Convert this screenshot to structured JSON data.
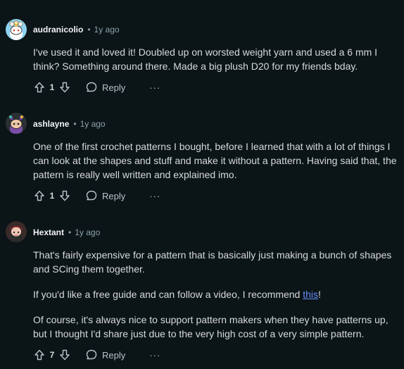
{
  "comments": [
    {
      "author": "audranicolio",
      "separator": "•",
      "time": "1y ago",
      "avatar_icon": "snoo-avatar-white-flower-hat",
      "paragraphs": [
        "I've used it and loved it! Doubled up on worsted weight yarn and used a 6 mm I think? Something around there. Made a big plush D20 for my friends bday."
      ],
      "votes": "1",
      "reply_label": "Reply",
      "more_label": "···"
    },
    {
      "author": "ashlayne",
      "separator": "•",
      "time": "1y ago",
      "avatar_icon": "snoo-avatar-purple-ears",
      "paragraphs": [
        "One of the first crochet patterns I bought, before I learned that with a lot of things I can look at the shapes and stuff and make it without a pattern. Having said that, the pattern is really well written and explained imo."
      ],
      "votes": "1",
      "reply_label": "Reply",
      "more_label": "···"
    },
    {
      "author": "Hextant",
      "separator": "•",
      "time": "1y ago",
      "avatar_icon": "snoo-avatar-red-hair",
      "paragraphs": [
        "That's fairly expensive for a pattern that is basically just making a bunch of shapes and SCing them together.",
        "Of course, it's always nice to support pattern makers when they have patterns up, but I thought I'd share just due to the very high cost of a very simple pattern."
      ],
      "link_paragraph": {
        "before": "If you'd like a free guide and can follow a video, I recommend ",
        "link_text": "this",
        "after": "!"
      },
      "votes": "7",
      "reply_label": "Reply",
      "more_label": "···"
    }
  ],
  "colors": {
    "background": "#0b1416",
    "text": "#d7dadc",
    "meta": "#8ba2ad",
    "link": "#648efc"
  }
}
